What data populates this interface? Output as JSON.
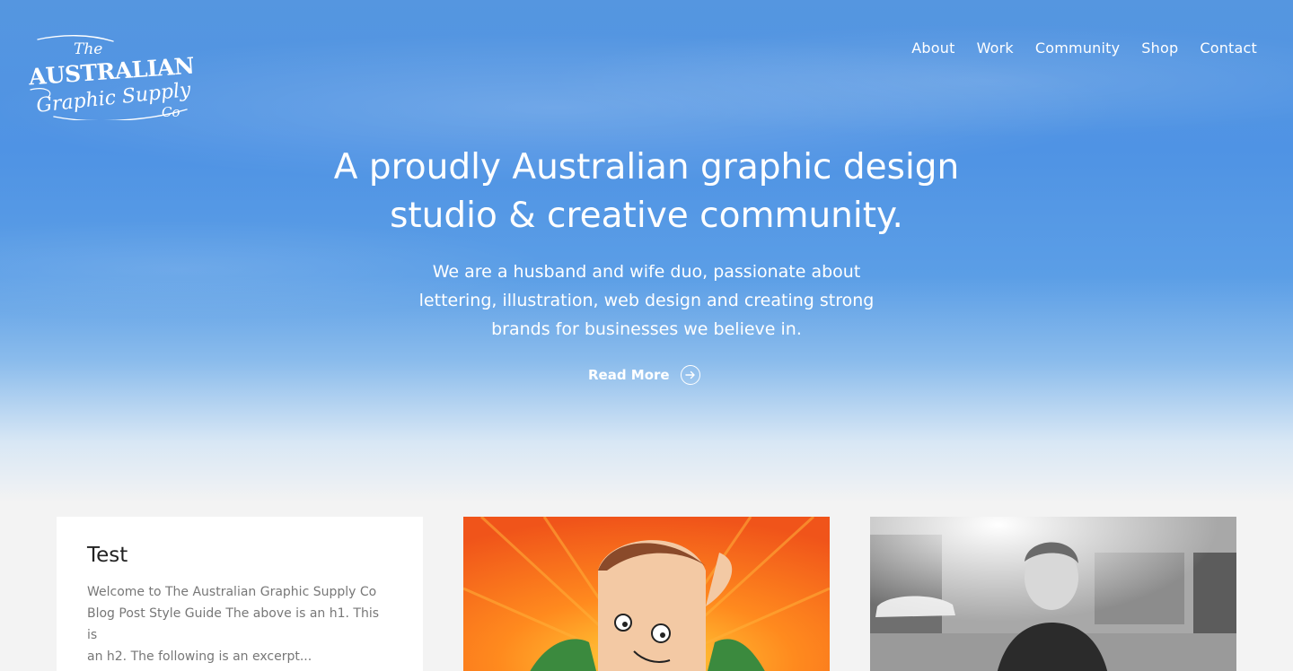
{
  "brand": {
    "logo_line1": "The",
    "logo_line2": "AUSTRALIAN",
    "logo_line3": "Graphic Supply",
    "logo_line4": "Co"
  },
  "nav": {
    "items": [
      {
        "label": "About"
      },
      {
        "label": "Work"
      },
      {
        "label": "Community"
      },
      {
        "label": "Shop"
      },
      {
        "label": "Contact"
      }
    ]
  },
  "hero": {
    "headline_line1": "A proudly Australian graphic design",
    "headline_line2": "studio & creative community.",
    "intro_line1": "We are a husband and wife duo, passionate about",
    "intro_line2": "lettering, illustration, web design and creating strong",
    "intro_line3": "brands for businesses we believe in.",
    "read_more_label": "Read More",
    "read_more_icon": "arrow-right-circle-icon"
  },
  "posts": [
    {
      "title": "Test",
      "excerpt_line1": "Welcome to The Australian Graphic Supply Co",
      "excerpt_line2": "Blog Post Style Guide The above is an h1.  This is",
      "excerpt_line3": "an h2.  The following is an excerpt..."
    }
  ],
  "colors": {
    "sky_blue": "#4f93e4",
    "page_bg": "#f3f3f3",
    "illustration_orange": "#f56a1f"
  }
}
